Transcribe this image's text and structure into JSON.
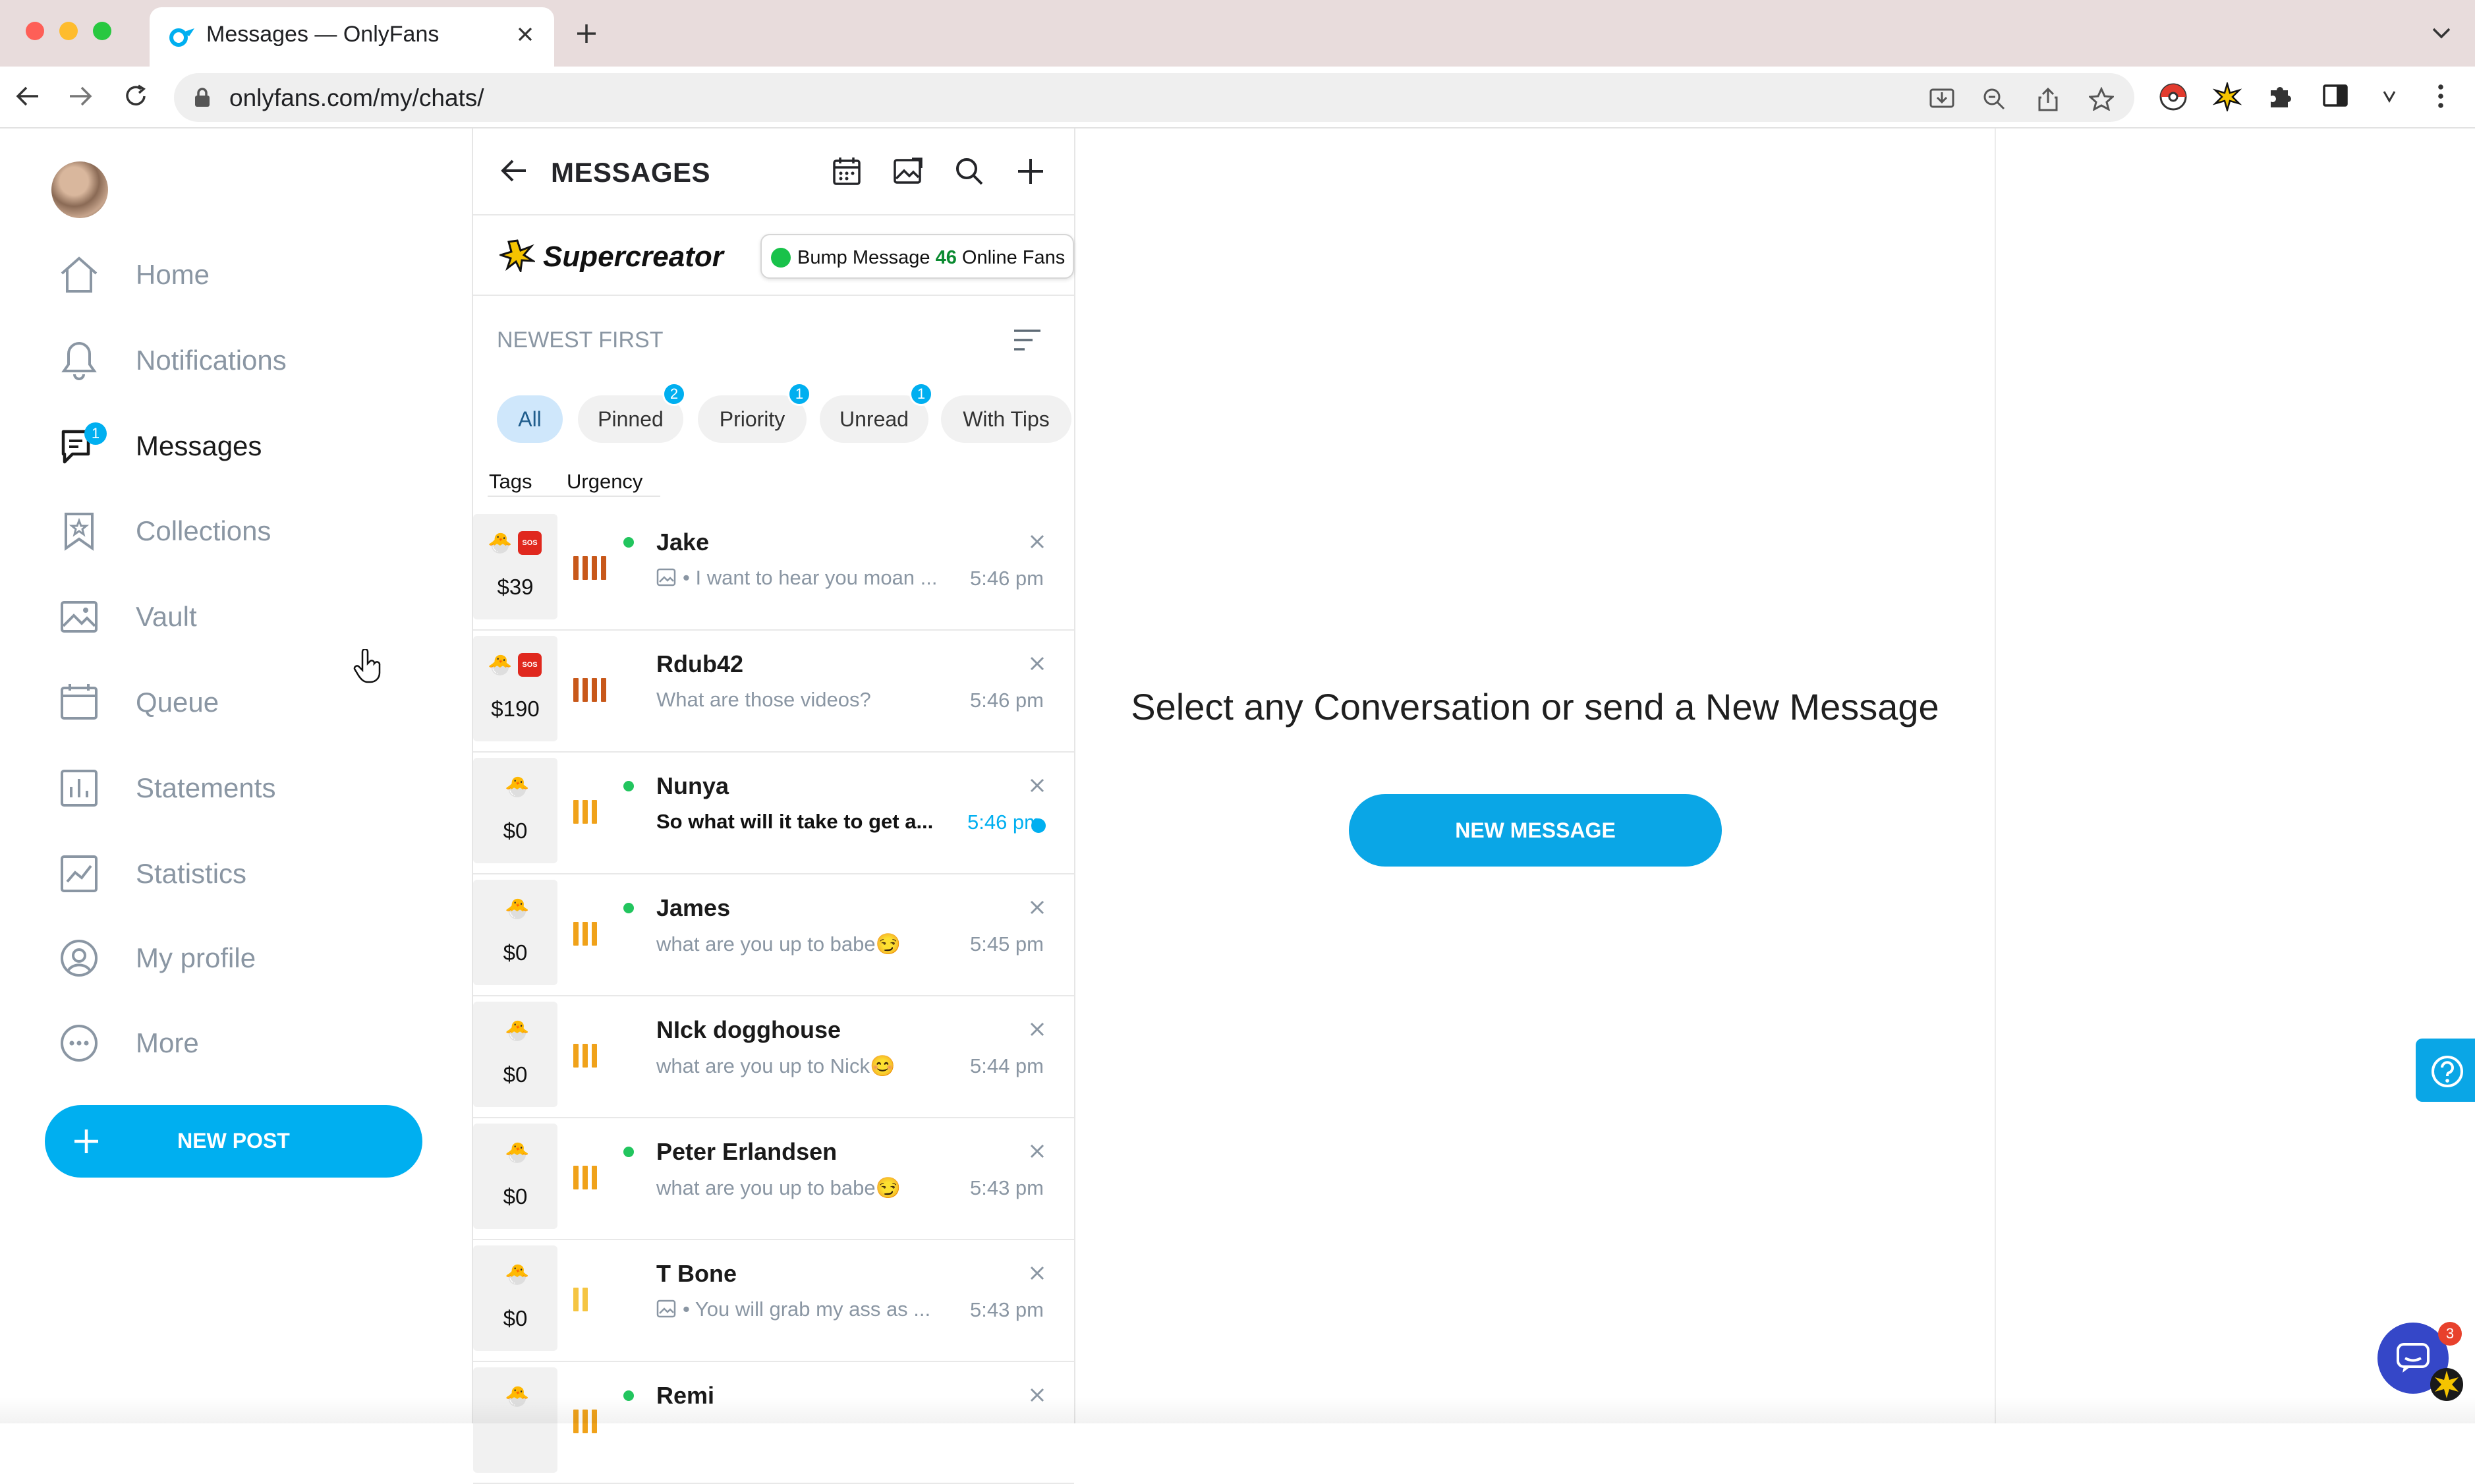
{
  "browser": {
    "tab_title": "Messages — OnlyFans",
    "url": "onlyfans.com/my/chats/"
  },
  "sidebar": {
    "items": [
      {
        "label": "Home",
        "icon": "home-icon"
      },
      {
        "label": "Notifications",
        "icon": "bell-icon"
      },
      {
        "label": "Messages",
        "icon": "chat-icon",
        "badge": "1",
        "active": true
      },
      {
        "label": "Collections",
        "icon": "bookmark-icon"
      },
      {
        "label": "Vault",
        "icon": "image-icon"
      },
      {
        "label": "Queue",
        "icon": "calendar-icon"
      },
      {
        "label": "Statements",
        "icon": "bar-chart-icon"
      },
      {
        "label": "Statistics",
        "icon": "line-chart-icon"
      },
      {
        "label": "My profile",
        "icon": "user-circle-icon"
      },
      {
        "label": "More",
        "icon": "more-icon"
      }
    ],
    "new_post_label": "NEW POST"
  },
  "messages": {
    "title": "MESSAGES",
    "supercreator": "Supercreator",
    "bump": {
      "text": "Bump Message",
      "count": "46",
      "suffix": "Online Fans"
    },
    "sort_label": "NEWEST FIRST",
    "filters": [
      {
        "label": "All",
        "active": true
      },
      {
        "label": "Pinned",
        "badge": "2"
      },
      {
        "label": "Priority",
        "badge": "1"
      },
      {
        "label": "Unread",
        "badge": "1"
      },
      {
        "label": "With Tips"
      }
    ],
    "column_headers": {
      "tags": "Tags",
      "urgency": "Urgency"
    },
    "chats": [
      {
        "name": "Jake",
        "preview": "• I want to hear you moan ...",
        "has_image": true,
        "time": "5:46 pm",
        "price": "$39",
        "online": true,
        "sos": true,
        "urgency": 4,
        "urgency_color": "#c8581a"
      },
      {
        "name": "Rdub42",
        "preview": "What are those videos?",
        "has_image": false,
        "time": "5:46 pm",
        "price": "$190",
        "online": false,
        "sos": true,
        "urgency": 4,
        "urgency_color": "#c8581a"
      },
      {
        "name": "Nunya",
        "preview": "So what will it take to get a...",
        "has_image": false,
        "time": "5:46 pm",
        "price": "$0",
        "online": true,
        "sos": false,
        "urgency": 3,
        "urgency_color": "#f0a21a",
        "unread": true
      },
      {
        "name": "James",
        "preview": "what are you up to babe😏",
        "has_image": false,
        "time": "5:45 pm",
        "price": "$0",
        "online": true,
        "sos": false,
        "urgency": 3,
        "urgency_color": "#f0a21a"
      },
      {
        "name": "NIck dogghouse",
        "preview": "what are you up to Nick😊",
        "has_image": false,
        "time": "5:44 pm",
        "price": "$0",
        "online": false,
        "sos": false,
        "urgency": 3,
        "urgency_color": "#f0a21a"
      },
      {
        "name": "Peter Erlandsen",
        "preview": "what are you up to babe😏",
        "has_image": false,
        "time": "5:43 pm",
        "price": "$0",
        "online": true,
        "sos": false,
        "urgency": 3,
        "urgency_color": "#f0a21a"
      },
      {
        "name": "T Bone",
        "preview": "• You will grab my ass as ...",
        "has_image": true,
        "time": "5:43 pm",
        "price": "$0",
        "online": false,
        "sos": false,
        "urgency": 2,
        "urgency_color": "#f5c542"
      },
      {
        "name": "Remi",
        "preview": "",
        "has_image": false,
        "time": "",
        "price": "",
        "online": true,
        "sos": false,
        "urgency": 3,
        "urgency_color": "#f0a21a"
      }
    ]
  },
  "main": {
    "empty_title": "Select any Conversation or send a New Message",
    "new_message_label": "NEW MESSAGE"
  },
  "chat_widget": {
    "badge": "3"
  },
  "colors": {
    "accent": "#00aff0",
    "online": "#22c55e",
    "sos": "#e0281e"
  }
}
